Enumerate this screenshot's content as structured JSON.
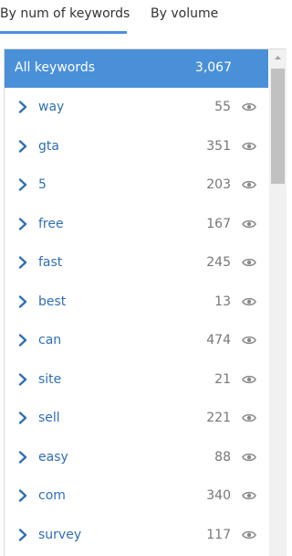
{
  "tabs": [
    {
      "label": "By num of keywords",
      "active": true
    },
    {
      "label": "By volume",
      "active": false
    }
  ],
  "summary": {
    "label": "All keywords",
    "count": "3,067"
  },
  "keywords": [
    {
      "label": "way",
      "count": "55"
    },
    {
      "label": "gta",
      "count": "351"
    },
    {
      "label": "5",
      "count": "203"
    },
    {
      "label": "free",
      "count": "167"
    },
    {
      "label": "fast",
      "count": "245"
    },
    {
      "label": "best",
      "count": "13"
    },
    {
      "label": "can",
      "count": "474"
    },
    {
      "label": "site",
      "count": "21"
    },
    {
      "label": "sell",
      "count": "221"
    },
    {
      "label": "easy",
      "count": "88"
    },
    {
      "label": "com",
      "count": "340"
    },
    {
      "label": "survey",
      "count": "117"
    }
  ],
  "icons": {
    "expand": "chevron-right-icon",
    "view": "eye-icon"
  },
  "colors": {
    "accent": "#4a90d9",
    "link": "#2f6fb5",
    "count": "#777777"
  }
}
